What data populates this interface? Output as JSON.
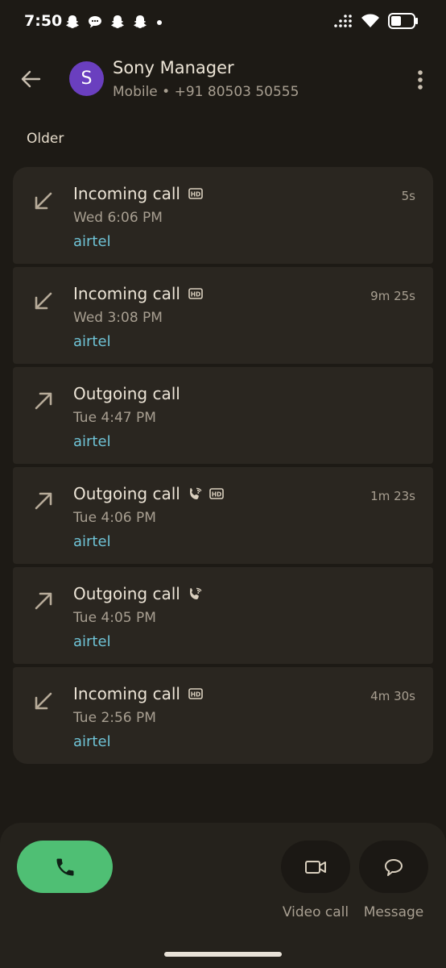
{
  "status_bar": {
    "time": "7:50",
    "notification_icons": [
      "snapchat-icon",
      "messages-icon",
      "snapchat-icon",
      "snapchat-icon",
      "more-dot-icon"
    ],
    "right_icons": [
      "signal-icon",
      "wifi-icon",
      "battery-icon"
    ]
  },
  "header": {
    "avatar_letter": "S",
    "name": "Sony Manager",
    "subtitle": "Mobile • +91 80503 50555"
  },
  "section_label": "Older",
  "calls": [
    {
      "type": "Incoming call",
      "direction": "incoming",
      "time": "Wed 6:06 PM",
      "carrier": "airtel",
      "duration": "5s",
      "wifi": false,
      "hd": true
    },
    {
      "type": "Incoming call",
      "direction": "incoming",
      "time": "Wed 3:08 PM",
      "carrier": "airtel",
      "duration": "9m 25s",
      "wifi": false,
      "hd": true
    },
    {
      "type": "Outgoing call",
      "direction": "outgoing",
      "time": "Tue 4:47 PM",
      "carrier": "airtel",
      "duration": "",
      "wifi": false,
      "hd": false
    },
    {
      "type": "Outgoing call",
      "direction": "outgoing",
      "time": "Tue 4:06 PM",
      "carrier": "airtel",
      "duration": "1m 23s",
      "wifi": true,
      "hd": true
    },
    {
      "type": "Outgoing call",
      "direction": "outgoing",
      "time": "Tue 4:05 PM",
      "carrier": "airtel",
      "duration": "",
      "wifi": true,
      "hd": false
    },
    {
      "type": "Incoming call",
      "direction": "incoming",
      "time": "Tue 2:56 PM",
      "carrier": "airtel",
      "duration": "4m 30s",
      "wifi": false,
      "hd": true
    }
  ],
  "bottom_actions": {
    "video_call_label": "Video call",
    "message_label": "Message"
  },
  "colors": {
    "background": "#1d1a15",
    "card": "#2a2620",
    "call_button": "#4fbf74",
    "carrier_text": "#6fc3d6",
    "avatar": "#6a3fbf"
  }
}
